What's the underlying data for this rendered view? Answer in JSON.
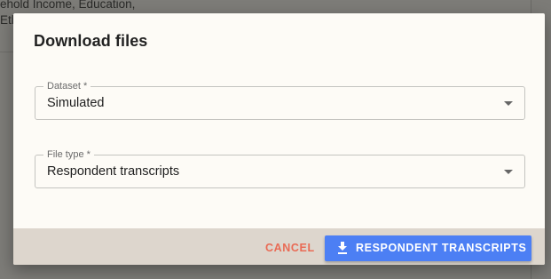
{
  "background": {
    "line1": "ehold Income, Education,",
    "line2": "Eth"
  },
  "dialog": {
    "title": "Download files",
    "fields": [
      {
        "label": "Dataset *",
        "value": "Simulated"
      },
      {
        "label": "File type *",
        "value": "Respondent transcripts"
      }
    ],
    "cancel_label": "CANCEL",
    "download_label": "RESPONDENT TRANSCRIPTS",
    "download_icon": "download-icon"
  },
  "colors": {
    "primary": "#4c7ff4",
    "cancel": "#e96b55",
    "footer": "#ddd6cd",
    "dialog_bg": "#fdfbf6"
  }
}
